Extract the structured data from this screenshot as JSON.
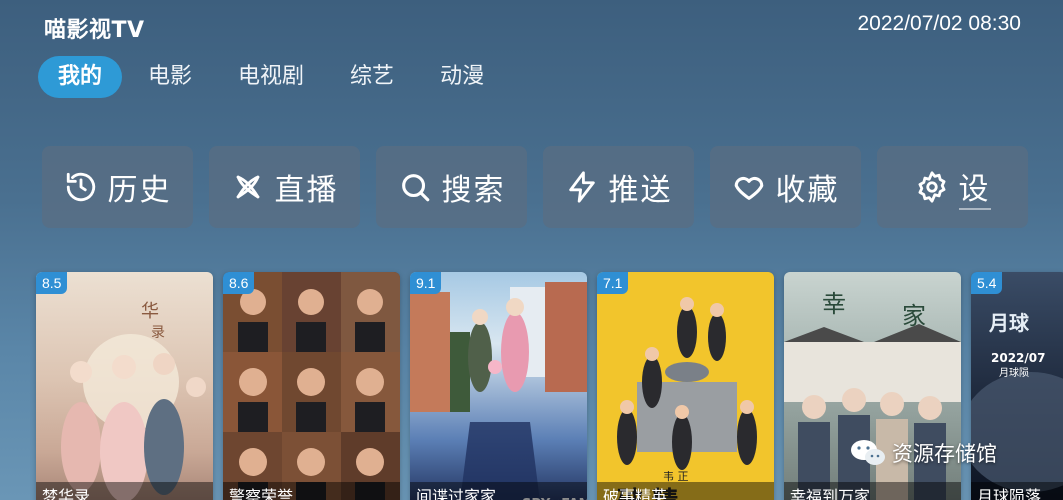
{
  "header": {
    "app_title": "喵影视TV",
    "datetime": "2022/07/02 08:30"
  },
  "nav": {
    "tabs": [
      {
        "label": "我的",
        "active": true
      },
      {
        "label": "电影",
        "active": false
      },
      {
        "label": "电视剧",
        "active": false
      },
      {
        "label": "综艺",
        "active": false
      },
      {
        "label": "动漫",
        "active": false
      }
    ]
  },
  "quick_actions": [
    {
      "label": "历史",
      "icon": "history-icon"
    },
    {
      "label": "直播",
      "icon": "live-icon"
    },
    {
      "label": "搜索",
      "icon": "search-icon"
    },
    {
      "label": "推送",
      "icon": "lightning-icon"
    },
    {
      "label": "收藏",
      "icon": "heart-icon"
    },
    {
      "label": "设",
      "icon": "gear-icon"
    }
  ],
  "recommend": [
    {
      "title": "梦华录",
      "rating": "8.5",
      "color_top": "#e9d6c8",
      "color_bottom": "#b99a8a"
    },
    {
      "title": "警察荣誉",
      "rating": "8.6",
      "color_top": "#7a5038",
      "color_bottom": "#3a2418"
    },
    {
      "title": "间谍过家家",
      "rating": "9.1",
      "color_top": "#8fb8d8",
      "color_bottom": "#1c2a55"
    },
    {
      "title": "破事精英",
      "rating": "7.1",
      "color_top": "#f3c62a",
      "color_bottom": "#d8a212"
    },
    {
      "title": "幸福到万家",
      "rating": "",
      "color_top": "#b7c4c2",
      "color_bottom": "#55605e"
    },
    {
      "title": "月球陨落",
      "rating": "5.4",
      "color_top": "#2a3a52",
      "color_bottom": "#0c1524"
    }
  ],
  "recommend_extra_text": [
    "2022/07",
    "月球陨"
  ],
  "watermark": {
    "text": "资源存储馆",
    "icon": "wechat-icon"
  },
  "colors": {
    "accent": "#2e9ad6",
    "rating_badge": "#2f8fd4"
  }
}
